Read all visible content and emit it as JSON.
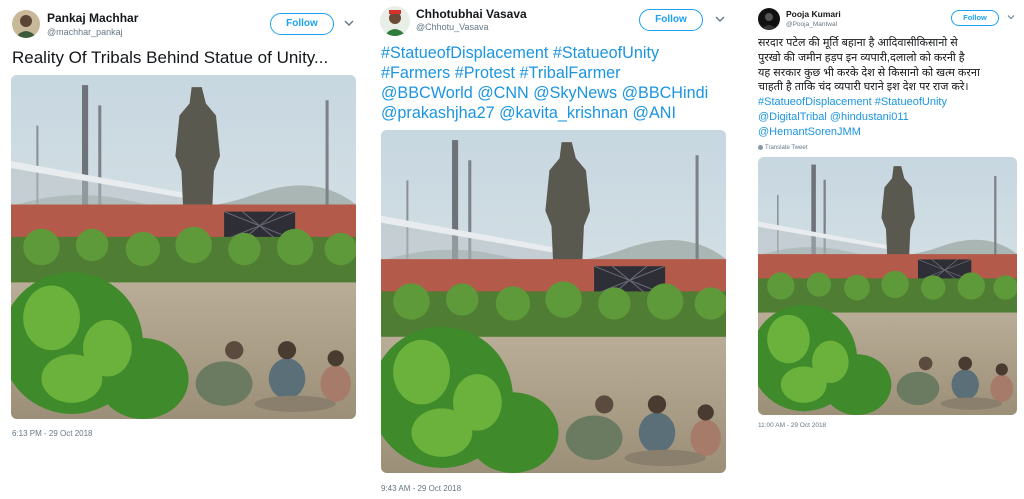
{
  "tweets": [
    {
      "name": "Pankaj Machhar",
      "handle": "@machhar_pankaj",
      "follow_label": "Follow",
      "text": "Reality Of Tribals Behind Statue of Unity...",
      "timestamp": "6:13 PM - 29 Oct 2018",
      "photo_alt": "Statue of Unity with tribal family eating outdoors"
    },
    {
      "name": "Chhotubhai Vasava",
      "handle": "@Chhotu_Vasava",
      "follow_label": "Follow",
      "hashtag_lines": [
        "#StatueofDisplacement #StatueofUnity",
        "#Farmers #Protest #TribalFarmer",
        "@BBCWorld @CNN @SkyNews @BBCHindi",
        "@prakashjha27 @kavita_krishnan @ANI"
      ],
      "timestamp": "9:43 AM - 29 Oct 2018",
      "photo_alt": "Statue of Unity with tribal family eating outdoors"
    },
    {
      "name": "Pooja Kumari",
      "handle": "@Pooja_Mantwal",
      "follow_label": "Follow",
      "text_lines": [
        "सरदार पटेल की मूर्ति बहाना है आदिवासीकिसानो से",
        "पुरखो की जमीन हड़प इन व्यपारी,दलालो को करनी है",
        "यह सरकार कुछ भी करके देश से किसानो को खत्म करना",
        "चाहती है ताकि चंद व्यपारी घराने इश देश पर राज करे।"
      ],
      "hashtag_lines": [
        "#StatueofDisplacement #StatueofUnity",
        "@DigitalTribal @hindustani011",
        "@HemantSorenJMM"
      ],
      "translate_label": "Translate Tweet",
      "timestamp": "11:00 AM - 29 Oct 2018",
      "photo_alt": "Statue of Unity with tribal family eating outdoors"
    }
  ],
  "colors": {
    "link": "#1b95e0",
    "follow": "#1da1f2",
    "meta": "#657786"
  }
}
